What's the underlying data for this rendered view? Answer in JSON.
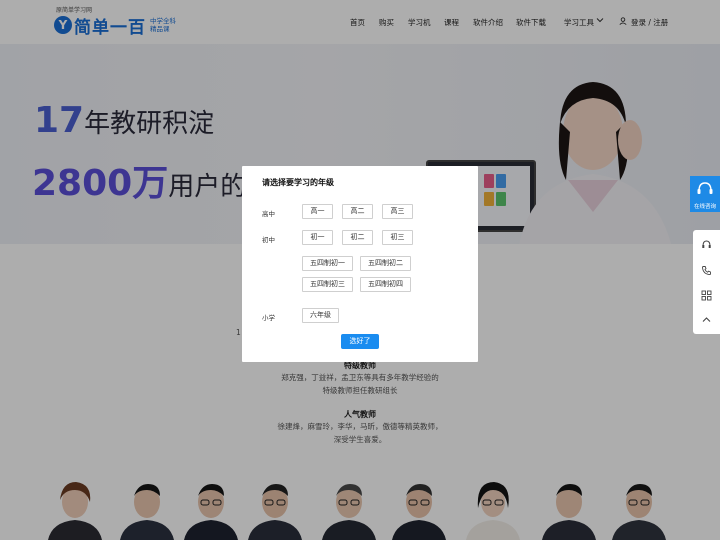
{
  "header": {
    "logo_tagline": "原简单学习网",
    "logo_mark": "Y",
    "logo_brand": "简单一百",
    "logo_sub": [
      "中学全科",
      "精品课"
    ],
    "nav": [
      "首页",
      "购买",
      "学习机",
      "课程",
      "软件介绍",
      "软件下载",
      "学习工具"
    ],
    "login": "登录 / 注册"
  },
  "banner": {
    "line1_num": "17",
    "line1_text": "年教研积淀",
    "line2_num": "2800万",
    "line2_text": "用户的选择"
  },
  "sections": {
    "partial_digit": "1",
    "special_title": "特级教师",
    "special_desc1": "郑克强，丁益祥，孟卫东等具有多年教学经验的",
    "special_desc2": "特级教师担任教研组长",
    "popular_title": "人气教师",
    "popular_desc1": "徐建烽，麻雪玲，李华，马昕，傲德等精英教师，",
    "popular_desc2": "深受学生喜爱。"
  },
  "float": {
    "consult": "在线咨询",
    "icons": [
      "headset-icon",
      "phone-icon",
      "qrcode-icon",
      "back-to-top-icon"
    ]
  },
  "modal": {
    "title": "请选择要学习的年级",
    "high_label": "高中",
    "high": [
      "高一",
      "高二",
      "高三"
    ],
    "middle_label": "初中",
    "middle": [
      "初一",
      "初二",
      "初三"
    ],
    "wusi": [
      "五四制初一",
      "五四制初二",
      "五四制初三",
      "五四制初四"
    ],
    "primary_label": "小学",
    "primary": [
      "六年级"
    ],
    "confirm": "选好了"
  },
  "colors": {
    "brand_blue": "#1a6fd6",
    "confirm_blue": "#1a8cf0",
    "float_blue": "#1e8ae6"
  }
}
